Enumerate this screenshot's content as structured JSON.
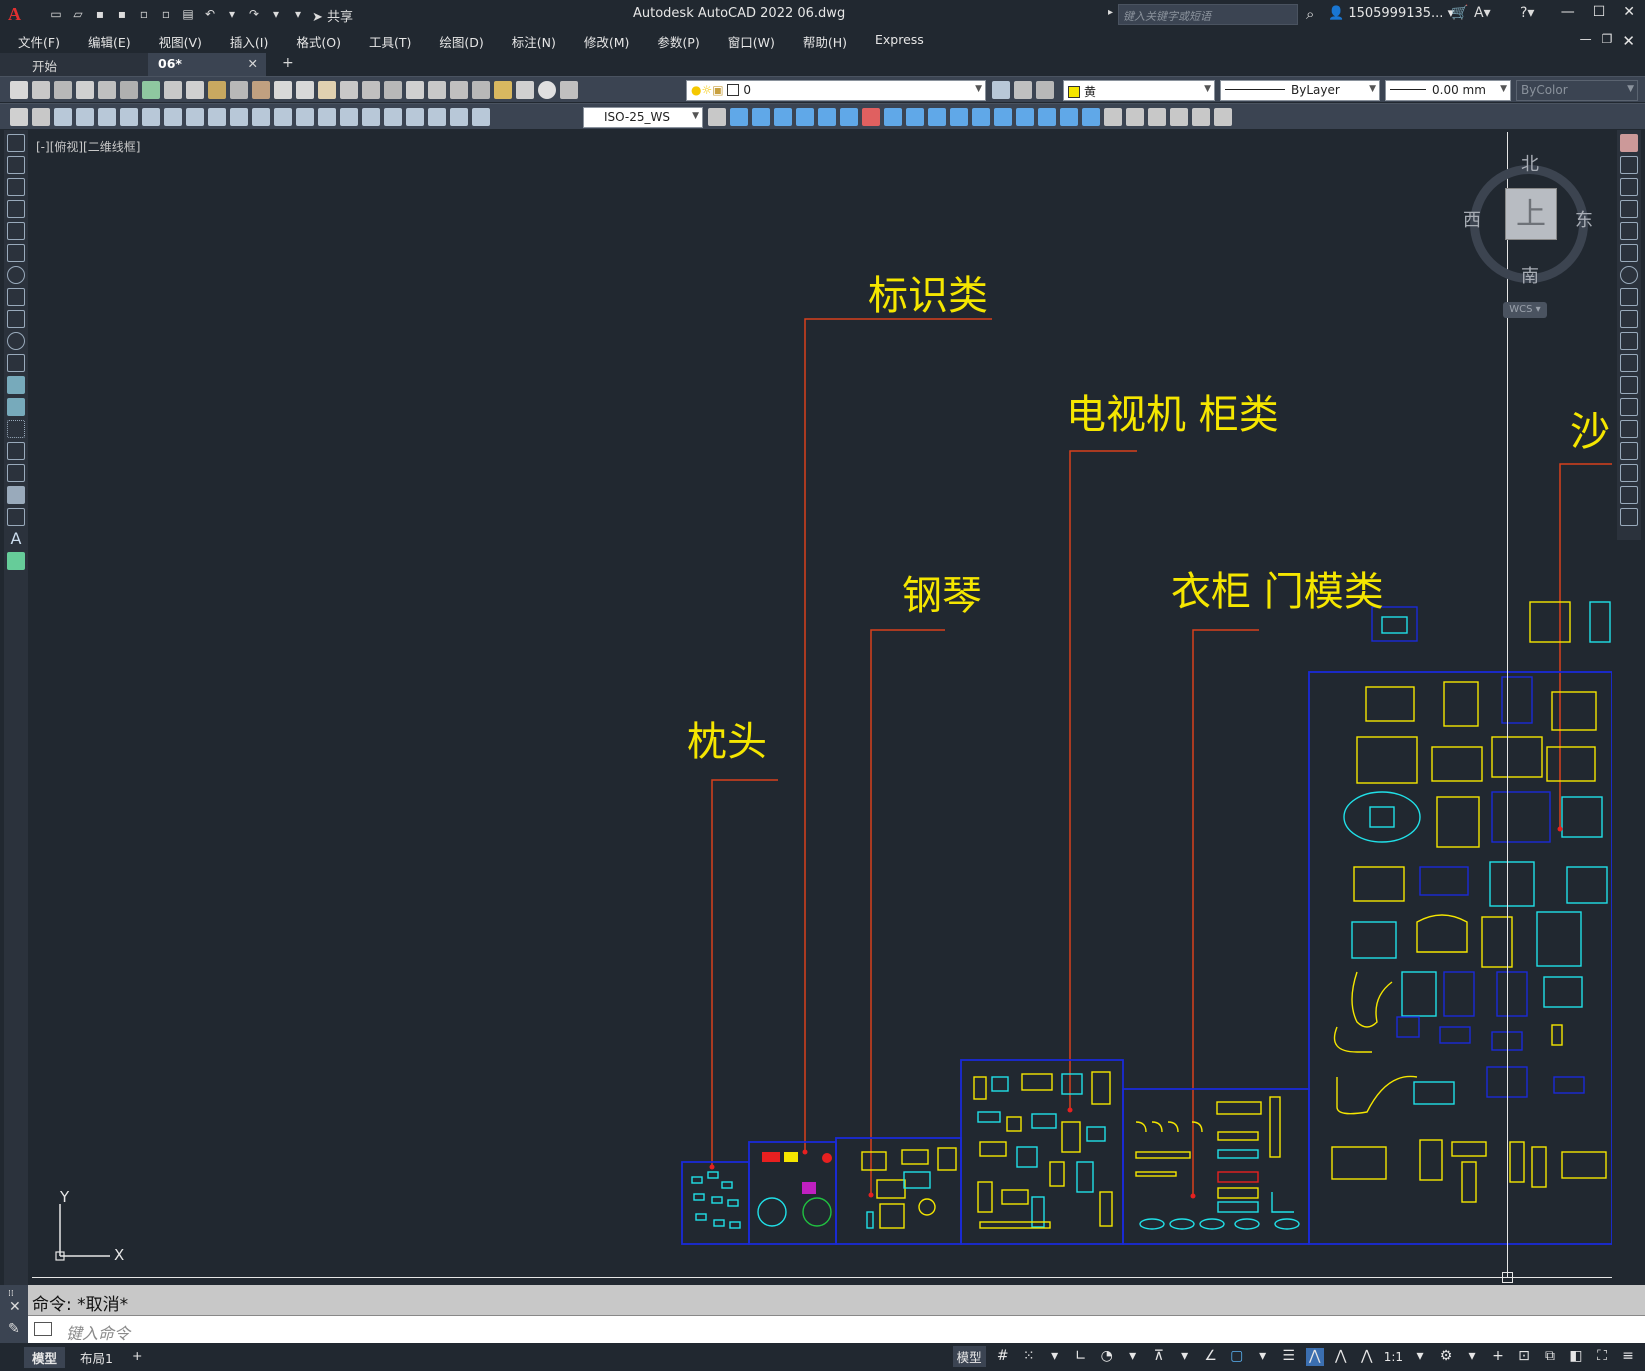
{
  "app": {
    "logo": "A",
    "title": "Autodesk AutoCAD 2022    06.dwg",
    "share_label": "共享",
    "search_placeholder": "键入关键字或短语",
    "user_label": "1505999135...",
    "window_buttons": [
      "—",
      "☐",
      "✕"
    ]
  },
  "menu": {
    "items": [
      "文件(F)",
      "编辑(E)",
      "视图(V)",
      "插入(I)",
      "格式(O)",
      "工具(T)",
      "绘图(D)",
      "标注(N)",
      "修改(M)",
      "参数(P)",
      "窗口(W)",
      "帮助(H)",
      "Express"
    ]
  },
  "tabs": {
    "start": "开始",
    "doc": "06*",
    "close": "✕",
    "add": "+"
  },
  "toolbar": {
    "layer_value": "0",
    "color_value": "黄",
    "linetype_value": "ByLayer",
    "lineweight_value": "0.00 mm",
    "plotstyle_value": "ByColor",
    "dimstyle_value": "ISO-25_WS",
    "accent_color": "#f5e600"
  },
  "viewport": {
    "label": "[-][俯视][二维线框]"
  },
  "viewcube": {
    "north": "北",
    "south": "南",
    "east": "东",
    "west": "西",
    "face": "上",
    "wcs": "WCS"
  },
  "ucs": {
    "x": "X",
    "y": "Y"
  },
  "drawing": {
    "labels": [
      "标识类",
      "电视机  柜类",
      "沙",
      "钢琴",
      "衣柜  门模类",
      "枕头"
    ],
    "label_color": "#f5e600",
    "leader_color": "#d8401c",
    "frame_color": "#1a2ad8"
  },
  "command": {
    "history": "命令:  *取消*",
    "placeholder": "键入命令"
  },
  "status": {
    "model_tab": "模型",
    "layout_tab": "布局1",
    "add": "+",
    "model_label": "模型",
    "scale": "1:1"
  }
}
